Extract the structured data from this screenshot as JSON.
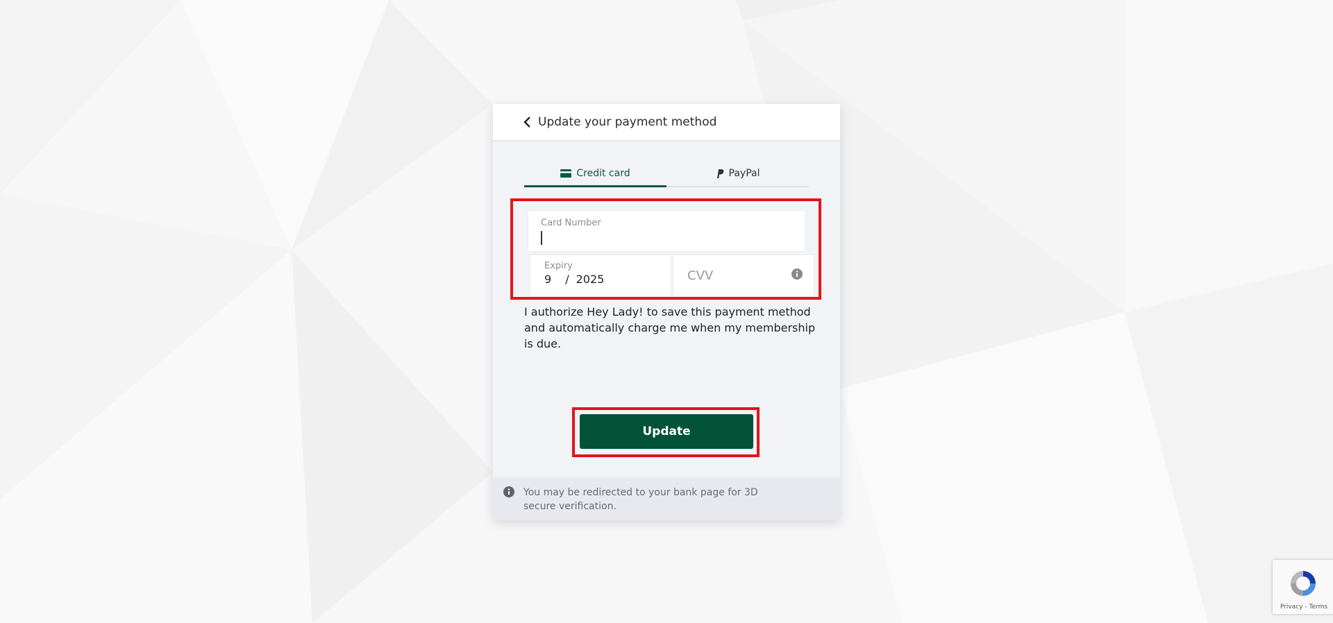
{
  "header": {
    "title": "Update your payment method"
  },
  "tabs": [
    {
      "label": "Credit card",
      "active": true
    },
    {
      "label": "PayPal",
      "active": false
    }
  ],
  "form": {
    "card_number_label": "Card Number",
    "card_number_value": "",
    "expiry_label": "Expiry",
    "expiry_month": "9",
    "expiry_separator": "/",
    "expiry_year": "2025",
    "cvv_placeholder": "CVV"
  },
  "authorize_text": "I authorize Hey Lady! to save this payment method and automatically charge me when my membership is due.",
  "update_button": "Update",
  "notice_text": "You may be redirected to your bank page for 3D secure verification.",
  "recaptcha": {
    "privacy": "Privacy",
    "separator": " - ",
    "terms": "Terms"
  },
  "colors": {
    "brand_green": "#035338",
    "highlight_red": "#e0161e"
  }
}
